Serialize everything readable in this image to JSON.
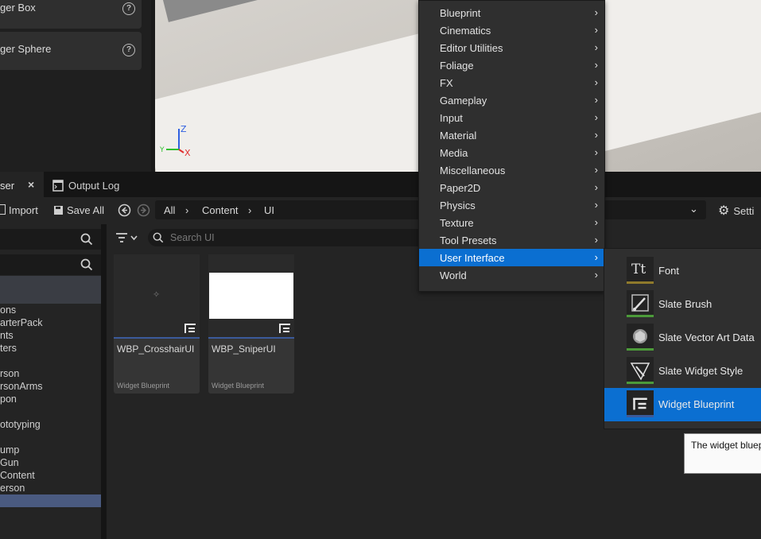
{
  "place_actors": {
    "items": [
      {
        "label": "ger Box"
      },
      {
        "label": "ger Sphere"
      }
    ]
  },
  "tabs": [
    {
      "label": "ser"
    },
    {
      "label": "Output Log"
    }
  ],
  "toolbar": {
    "import_label": "Import",
    "save_all_label": "Save All",
    "breadcrumbs": [
      "All",
      "Content",
      "UI"
    ],
    "settings_label": "Setti"
  },
  "search": {
    "placeholder": "Search UI"
  },
  "tree": {
    "items": [
      "ons",
      "arterPack",
      "nts",
      "ters",
      "rson",
      "rsonArms",
      "pon",
      "ototyping",
      "ump",
      "Gun",
      "Content",
      "erson"
    ]
  },
  "assets": [
    {
      "name": "WBP_CrosshairUI",
      "type": "Widget Blueprint"
    },
    {
      "name": "WBP_SniperUI",
      "type": "Widget Blueprint"
    }
  ],
  "menu": {
    "items": [
      "Blueprint",
      "Cinematics",
      "Editor Utilities",
      "Foliage",
      "FX",
      "Gameplay",
      "Input",
      "Material",
      "Media",
      "Miscellaneous",
      "Paper2D",
      "Physics",
      "Texture",
      "Tool Presets",
      "User Interface",
      "World"
    ],
    "selected": "User Interface"
  },
  "submenu": {
    "items": [
      {
        "label": "Font",
        "color": "#8f7a2b"
      },
      {
        "label": "Slate Brush",
        "color": "#4c9a3a"
      },
      {
        "label": "Slate Vector Art Data",
        "color": "#4c9a3a"
      },
      {
        "label": "Slate Widget Style",
        "color": "#4c9a3a"
      },
      {
        "label": "Widget Blueprint",
        "color": "#3b5a9b"
      }
    ],
    "selected": "Widget Blueprint"
  },
  "tooltip": {
    "text": "The widget bluep"
  },
  "colors": {
    "accent": "#0b6fd1",
    "panel": "#242424",
    "menu": "#2f2f2f"
  }
}
